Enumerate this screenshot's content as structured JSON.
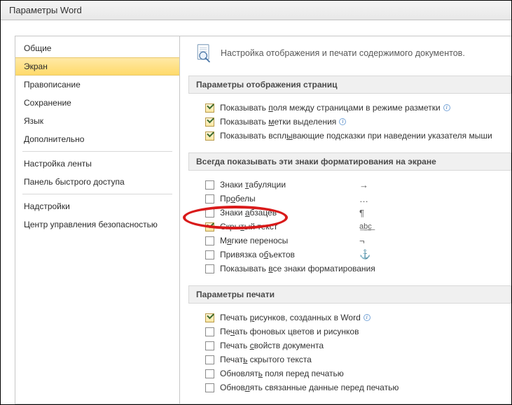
{
  "title": "Параметры Word",
  "sidebar": {
    "items": [
      "Общие",
      "Экран",
      "Правописание",
      "Сохранение",
      "Язык",
      "Дополнительно",
      "Настройка ленты",
      "Панель быстрого доступа",
      "Надстройки",
      "Центр управления безопасностью"
    ],
    "selected_index": 1
  },
  "header": {
    "text": "Настройка отображения и печати содержимого документов."
  },
  "section1": {
    "title": "Параметры отображения страниц",
    "items": [
      {
        "checked": true,
        "pre": "Показывать ",
        "u": "п",
        "post": "оля между страницами в режиме разметки",
        "info": true
      },
      {
        "checked": true,
        "pre": "Показывать ",
        "u": "м",
        "post": "етки выделения",
        "info": true
      },
      {
        "checked": true,
        "pre": "Показывать вспл",
        "u": "ы",
        "post": "вающие подсказки при наведении указателя мыши",
        "info": false
      }
    ]
  },
  "section2": {
    "title": "Всегда показывать эти знаки форматирования на экране",
    "items": [
      {
        "checked": false,
        "pre": "Знаки ",
        "u": "т",
        "post": "абуляции",
        "sym": "→"
      },
      {
        "checked": false,
        "pre": "Пр",
        "u": "о",
        "post": "белы",
        "sym": "…"
      },
      {
        "checked": false,
        "pre": "Знаки ",
        "u": "а",
        "post": "бзацев",
        "sym": "¶"
      },
      {
        "checked": true,
        "pre": "Скры",
        "u": "т",
        "post": "ый текст",
        "sym": "a͟b͟c͟"
      },
      {
        "checked": false,
        "pre": "М",
        "u": "я",
        "post": "гкие переносы",
        "sym": "¬"
      },
      {
        "checked": false,
        "pre": "Привязка о",
        "u": "б",
        "post": "ъектов",
        "sym": "⚓"
      },
      {
        "checked": false,
        "pre": "Показывать ",
        "u": "в",
        "post": "се знаки форматирования",
        "sym": ""
      }
    ]
  },
  "section3": {
    "title": "Параметры печати",
    "items": [
      {
        "checked": true,
        "pre": "Печать ",
        "u": "р",
        "post": "исунков, созданных в Word",
        "info": true
      },
      {
        "checked": false,
        "pre": "Пе",
        "u": "ч",
        "post": "ать фоновых цветов и рисунков"
      },
      {
        "checked": false,
        "pre": "Печать ",
        "u": "с",
        "post": "войств документа"
      },
      {
        "checked": false,
        "pre": "Печат",
        "u": "ь",
        "post": " скрытого текста"
      },
      {
        "checked": false,
        "pre": "Обновлят",
        "u": "ь",
        "post": " поля перед печатью"
      },
      {
        "checked": false,
        "pre": "Обнов",
        "u": "л",
        "post": "ять связанные данные перед печатью"
      }
    ]
  }
}
